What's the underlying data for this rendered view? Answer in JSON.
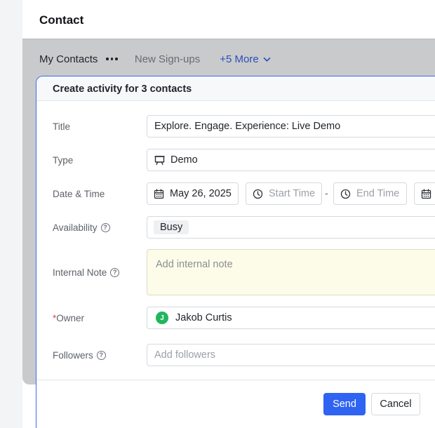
{
  "app": {
    "title": "Contact"
  },
  "tabs": {
    "my_contacts": "My Contacts",
    "new_signups": "New Sign-ups",
    "more": "+5 More"
  },
  "dialog": {
    "title": "Create activity for 3 contacts",
    "fields": {
      "title": {
        "label": "Title",
        "value": "Explore. Engage. Experience: Live Demo"
      },
      "type": {
        "label": "Type",
        "value": "Demo",
        "icon": "presentation-icon"
      },
      "datetime": {
        "label": "Date & Time",
        "date": "May 26, 2025",
        "start_placeholder": "Start Time",
        "separator": "-",
        "end_placeholder": "End Time"
      },
      "availability": {
        "label": "Availability",
        "value": "Busy"
      },
      "internal_note": {
        "label": "Internal Note",
        "placeholder": "Add internal note"
      },
      "owner": {
        "required_mark": "*",
        "label": "Owner",
        "value": "Jakob Curtis",
        "avatar_initial": "J",
        "avatar_color": "#22b55e"
      },
      "followers": {
        "label": "Followers",
        "placeholder": "Add followers"
      }
    },
    "actions": {
      "send": "Send",
      "cancel": "Cancel"
    }
  },
  "colors": {
    "accent": "#2f63f2",
    "link": "#2a4fb8",
    "note_background": "#fcfce8",
    "overlay": "#c9cacc"
  }
}
